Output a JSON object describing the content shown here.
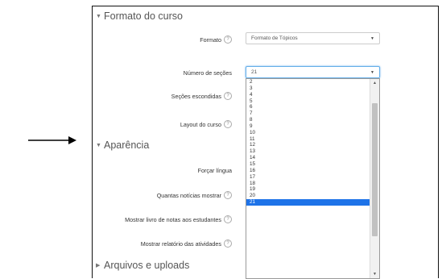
{
  "sections": {
    "formato_do_curso": "Formato do curso",
    "aparencia": "Aparência",
    "arquivos": "Arquivos e uploads"
  },
  "fields": {
    "formato": {
      "label": "Formato",
      "value": "Formato de Tópicos"
    },
    "numero_secoes": {
      "label": "Número de seções",
      "value": "21"
    },
    "secoes_escondidas": {
      "label": "Seções escondidas"
    },
    "layout": {
      "label": "Layout do curso"
    },
    "forcar_lingua": {
      "label": "Forçar língua"
    },
    "noticias": {
      "label": "Quantas notícias mostrar"
    },
    "notas": {
      "label": "Mostrar livro de notas aos estudantes"
    },
    "relatorio": {
      "label": "Mostrar relatório das atividades"
    }
  },
  "help_icon": "?",
  "dropdown_options": [
    "2",
    "3",
    "4",
    "5",
    "6",
    "7",
    "8",
    "9",
    "10",
    "11",
    "12",
    "13",
    "14",
    "15",
    "16",
    "17",
    "18",
    "19",
    "20",
    "21"
  ],
  "dropdown_selected": "21",
  "colors": {
    "selected": "#1e73e8",
    "focus_border": "#66afe9"
  }
}
